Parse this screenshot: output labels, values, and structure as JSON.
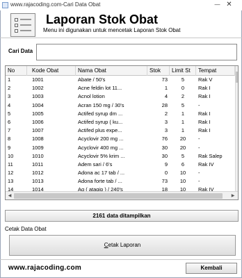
{
  "window": {
    "title": "www.rajacoding.com-Cari Data Obat"
  },
  "header": {
    "title": "Laporan Stok Obat",
    "subtitle": "Menu ini digunakan untuk mencetak Laporan Stok Obat"
  },
  "search": {
    "label": "Cari Data",
    "value": ""
  },
  "table": {
    "columns": [
      "No",
      "Kode Obat",
      "Nama Obat",
      "Stok",
      "Limit St",
      "Tempat"
    ],
    "rows": [
      [
        "1",
        "1001",
        "Abate / 50's",
        "73",
        "5",
        "Rak V"
      ],
      [
        "2",
        "1002",
        "Acne feldin lot 11...",
        "1",
        "0",
        "Rak I"
      ],
      [
        "3",
        "1003",
        "Acnol lotion",
        "4",
        "2",
        "Rak I"
      ],
      [
        "4",
        "1004",
        "Acran 150 mg / 30's",
        "28",
        "5",
        "-"
      ],
      [
        "5",
        "1005",
        "Actifed syrup dm ...",
        "2",
        "1",
        "Rak I"
      ],
      [
        "6",
        "1006",
        "Actifed syrup ( ku...",
        "3",
        "1",
        "Rak I"
      ],
      [
        "7",
        "1007",
        "Actifed plus expe...",
        "3",
        "1",
        "Rak I"
      ],
      [
        "8",
        "1008",
        "Acyclovir 200 mg ...",
        "76",
        "20",
        "-"
      ],
      [
        "9",
        "1009",
        "Acyclovir 400 mg ...",
        "30",
        "20",
        "-"
      ],
      [
        "10",
        "1010",
        "Acyclovir 5% krim ...",
        "30",
        "5",
        "Rak Salep"
      ],
      [
        "11",
        "1011",
        "Adem sari / 6's",
        "9",
        "6",
        "Rak IV"
      ],
      [
        "12",
        "1012",
        "Adona ac 17 tab / ...",
        "0",
        "10",
        "-"
      ],
      [
        "13",
        "1013",
        "Adona forte tab / ...",
        "73",
        "10",
        "-"
      ],
      [
        "14",
        "1014",
        "Ag ( atagip ) / 240's",
        "18",
        "10",
        "Rak IV"
      ],
      [
        "15",
        "1015",
        "Aito tts mata",
        "8",
        "1",
        "Rak II"
      ]
    ]
  },
  "status": {
    "count_label": "2161 data ditampilkan"
  },
  "print": {
    "section_label": "Cetak Data Obat",
    "button_prefix": "",
    "button_mnemonic": "C",
    "button_rest": "etak Laporan"
  },
  "footer": {
    "url": "www.rajacoding.com",
    "back_label": "Kembali"
  },
  "icons": {
    "app": "window-app-icon",
    "header": "document-list-icon",
    "minimize": "minimize-icon",
    "close": "close-icon"
  }
}
